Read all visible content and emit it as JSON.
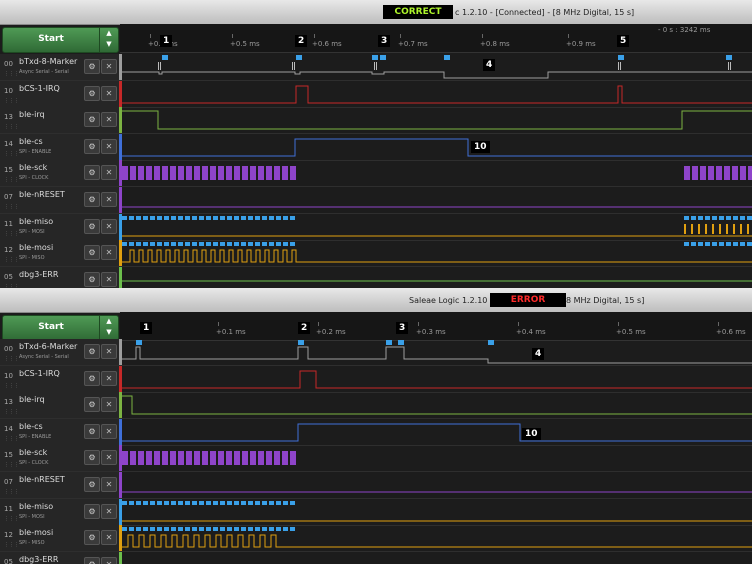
{
  "top_panel": {
    "title_text": "c 1.2.10 - [Connected] - [8 MHz Digital, 15 s]",
    "tag": "CORRECT",
    "time_readout": "- 0 s : 3242 ms",
    "start_label": "Start",
    "ticks": [
      "+0.4 ms",
      "+0.5 ms",
      "+0.6 ms",
      "+0.7 ms",
      "+0.8 ms",
      "+0.9 ms"
    ],
    "markers": [
      "1",
      "2",
      "3",
      "4",
      "5",
      "10"
    ],
    "channels": [
      {
        "num": "00",
        "name": "bTxd-8-Marker",
        "sub": "Async Serial - Serial"
      },
      {
        "num": "10",
        "name": "bCS-1-IRQ",
        "sub": ""
      },
      {
        "num": "13",
        "name": "ble-irq",
        "sub": ""
      },
      {
        "num": "14",
        "name": "ble-cs",
        "sub": "SPI - ENABLE"
      },
      {
        "num": "15",
        "name": "ble-sck",
        "sub": "SPI - CLOCK"
      },
      {
        "num": "07",
        "name": "ble-nRESET",
        "sub": ""
      },
      {
        "num": "11",
        "name": "ble-miso",
        "sub": "SPI - MOSI"
      },
      {
        "num": "12",
        "name": "ble-mosi",
        "sub": "SPI - MISO"
      },
      {
        "num": "05",
        "name": "dbg3-ERR",
        "sub": ""
      }
    ]
  },
  "bottom_panel": {
    "title_text": "Saleae Logic 1.2.10",
    "title_suffix": "8 MHz Digital, 15 s]",
    "tag": "ERROR",
    "start_label": "Start",
    "ticks": [
      "+0.1 ms",
      "+0.2 ms",
      "+0.3 ms",
      "+0.4 ms",
      "+0.5 ms",
      "+0.6 ms"
    ],
    "markers": [
      "1",
      "2",
      "3",
      "4",
      "10"
    ],
    "channels": [
      {
        "num": "00",
        "name": "bTxd-6-Marker",
        "sub": "Async Serial - Serial"
      },
      {
        "num": "10",
        "name": "bCS-1-IRQ",
        "sub": ""
      },
      {
        "num": "13",
        "name": "ble-irq",
        "sub": ""
      },
      {
        "num": "14",
        "name": "ble-cs",
        "sub": "SPI - ENABLE"
      },
      {
        "num": "15",
        "name": "ble-sck",
        "sub": "SPI - CLOCK"
      },
      {
        "num": "07",
        "name": "ble-nRESET",
        "sub": ""
      },
      {
        "num": "11",
        "name": "ble-miso",
        "sub": "SPI - MOSI"
      },
      {
        "num": "12",
        "name": "ble-mosi",
        "sub": "SPI - MISO"
      },
      {
        "num": "05",
        "name": "dbg3-ERR",
        "sub": ""
      }
    ]
  },
  "icons": {
    "gear": "gear-icon",
    "close": "close-icon",
    "grip": "grip-icon",
    "arrows": "up-down-arrows-icon",
    "nav": "arrow-nav-icon"
  },
  "colors": {
    "ch00": "#9e9e9e",
    "ch10": "#c62828",
    "ch13": "#7cb342",
    "ch14": "#3f6fd8",
    "ch15": "#8e44c9",
    "ch07": "#8e44c9",
    "ch11": "#3aa0e8",
    "ch12": "#e0a010",
    "ch05": "#6cbf4c",
    "marker_bg": "#000000"
  }
}
